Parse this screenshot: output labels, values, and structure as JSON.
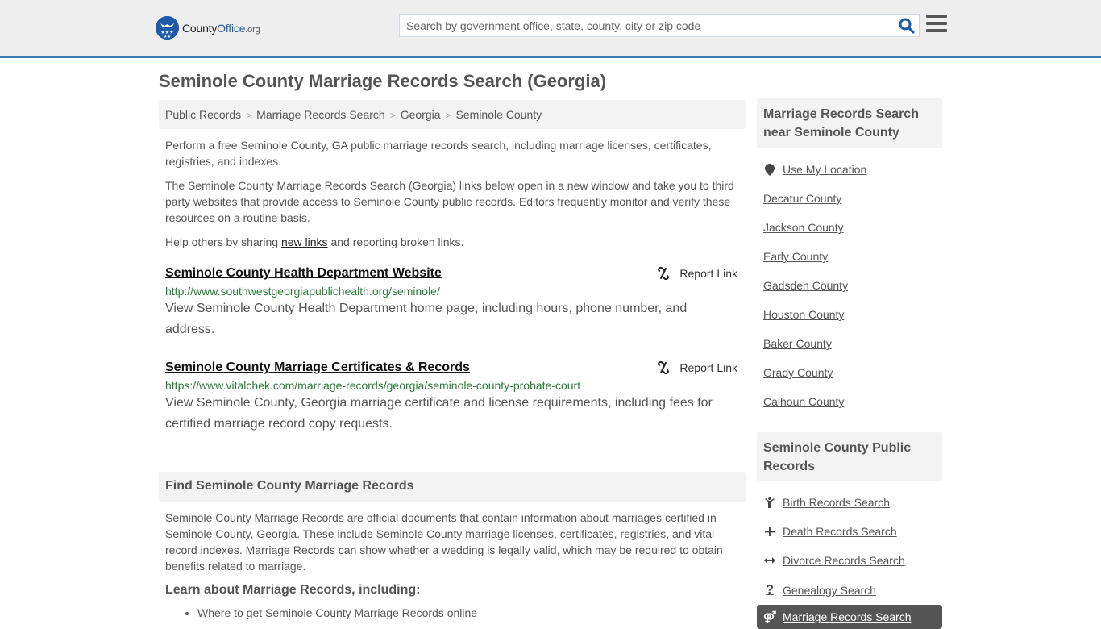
{
  "header": {
    "logo": {
      "name": "County",
      "name_accent": "Office",
      "tld": ".org"
    },
    "search": {
      "placeholder": "Search by government office, state, county, city or zip code",
      "value": ""
    },
    "icons": {
      "search": "search-icon",
      "menu": "hamburger-menu-icon"
    }
  },
  "page": {
    "title": "Seminole County Marriage Records Search (Georgia)",
    "breadcrumb": [
      "Public Records",
      "Marriage Records Search",
      "Georgia",
      "Seminole County"
    ],
    "intro": {
      "p1": "Perform a free Seminole County, GA public marriage records search, including marriage licenses, certificates, registries, and indexes.",
      "p2": "The Seminole County Marriage Records Search (Georgia) links below open in a new window and take you to third party websites that provide access to Seminole County public records. Editors frequently monitor and verify these resources on a routine basis.",
      "p3_before": "Help others by sharing ",
      "p3_link": "new links",
      "p3_after": " and reporting broken links."
    },
    "results": [
      {
        "title": "Seminole County Health Department Website",
        "url": "http://www.southwestgeorgiapublichealth.org/seminole/",
        "description": "View Seminole County Health Department home page, including hours, phone number, and address.",
        "report_label": "Report Link"
      },
      {
        "title": "Seminole County Marriage Certificates & Records",
        "url": "https://www.vitalchek.com/marriage-records/georgia/seminole-county-probate-court",
        "description": "View Seminole County, Georgia marriage certificate and license requirements, including fees for certified marriage record copy requests.",
        "report_label": "Report Link"
      }
    ],
    "find": {
      "heading": "Find Seminole County Marriage Records",
      "body": "Seminole County Marriage Records are official documents that contain information about marriages certified in Seminole County, Georgia. These include Seminole County marriage licenses, certificates, registries, and vital record indexes. Marriage Records can show whether a wedding is legally valid, which may be required to obtain benefits related to marriage.",
      "learn_heading": "Learn about Marriage Records, including:",
      "learn_items": [
        "Where to get Seminole County Marriage Records online"
      ]
    }
  },
  "sidebar": {
    "nearby": {
      "heading": "Marriage Records Search near Seminole County",
      "use_location": "Use My Location",
      "counties": [
        "Decatur County",
        "Jackson County",
        "Early County",
        "Gadsden County",
        "Houston County",
        "Baker County",
        "Grady County",
        "Calhoun County"
      ]
    },
    "public_records": {
      "heading": "Seminole County Public Records",
      "items": [
        {
          "label": "Birth Records Search",
          "icon": "child-icon",
          "glyph": "Ÿ"
        },
        {
          "label": "Death Records Search",
          "icon": "plus-icon",
          "glyph": "+"
        },
        {
          "label": "Divorce Records Search",
          "icon": "arrows-horizontal-icon",
          "glyph": "↔"
        },
        {
          "label": "Genealogy Search",
          "icon": "question-icon",
          "glyph": "?"
        }
      ],
      "active": {
        "label": "Marriage Records Search",
        "icon": "marriage-icon",
        "glyph": "⚤"
      }
    }
  },
  "colors": {
    "accent": "#3b7bb0",
    "brand_blue": "#1e5aa8",
    "url_green": "#2a7a3a",
    "header_bg": "#eeeeee",
    "panel_bg": "#f3f3f3",
    "active_bg": "#555555"
  }
}
